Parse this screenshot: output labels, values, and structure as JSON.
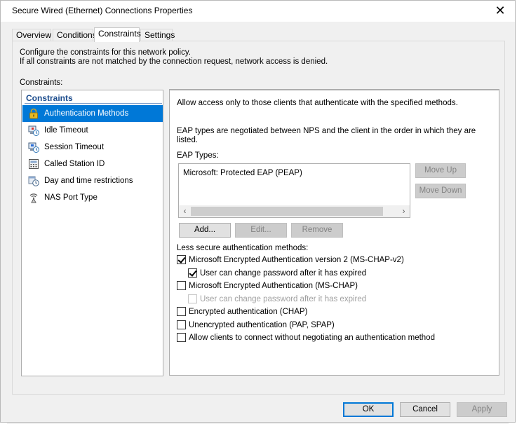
{
  "window": {
    "title": "Secure Wired (Ethernet) Connections Properties",
    "close_glyph": "✕"
  },
  "tabs": [
    {
      "label": "Overview"
    },
    {
      "label": "Conditions"
    },
    {
      "label": "Constraints",
      "active": true
    },
    {
      "label": "Settings"
    }
  ],
  "description": {
    "line1": "Configure the constraints for this network policy.",
    "line2": "If all constraints are not matched by the connection request, network access is denied."
  },
  "constraints_label": "Constraints:",
  "constraints_list": {
    "header": "Constraints",
    "items": [
      {
        "label": "Authentication Methods",
        "icon": "lock-icon",
        "selected": true
      },
      {
        "label": "Idle Timeout",
        "icon": "idle-timeout-icon"
      },
      {
        "label": "Session Timeout",
        "icon": "session-timeout-icon"
      },
      {
        "label": "Called Station ID",
        "icon": "station-id-icon"
      },
      {
        "label": "Day and time restrictions",
        "icon": "clock-icon"
      },
      {
        "label": "NAS Port Type",
        "icon": "antenna-icon"
      }
    ]
  },
  "auth": {
    "intro": "Allow access only to those clients that authenticate with the specified methods.",
    "eap_note_line1": "EAP types are negotiated between NPS and the client in the order in which they are",
    "eap_note_line2": "listed.",
    "eap_types_label": "EAP Types:",
    "eap_types": [
      "Microsoft: Protected EAP (PEAP)"
    ],
    "move_up": "Move Up",
    "move_down": "Move Down",
    "add": "Add...",
    "edit": "Edit...",
    "remove": "Remove",
    "less_secure_label": "Less secure authentication methods:",
    "methods": [
      {
        "label": "Microsoft Encrypted Authentication version 2 (MS-CHAP-v2)",
        "checked": true
      },
      {
        "label": "User can change password after it has expired",
        "checked": true
      },
      {
        "label": "Microsoft Encrypted Authentication (MS-CHAP)",
        "checked": false
      },
      {
        "label": "User can change password after it has expired",
        "checked": false,
        "disabled": true
      },
      {
        "label": "Encrypted authentication (CHAP)",
        "checked": false
      },
      {
        "label": "Unencrypted authentication (PAP, SPAP)",
        "checked": false
      },
      {
        "label": "Allow clients to connect without negotiating an authentication method",
        "checked": false
      }
    ]
  },
  "footer": {
    "ok": "OK",
    "cancel": "Cancel",
    "apply": "Apply"
  },
  "colors": {
    "selection": "#0078d7",
    "header_text": "#1a4b8c",
    "dialog_bg": "#f0f0f0"
  }
}
